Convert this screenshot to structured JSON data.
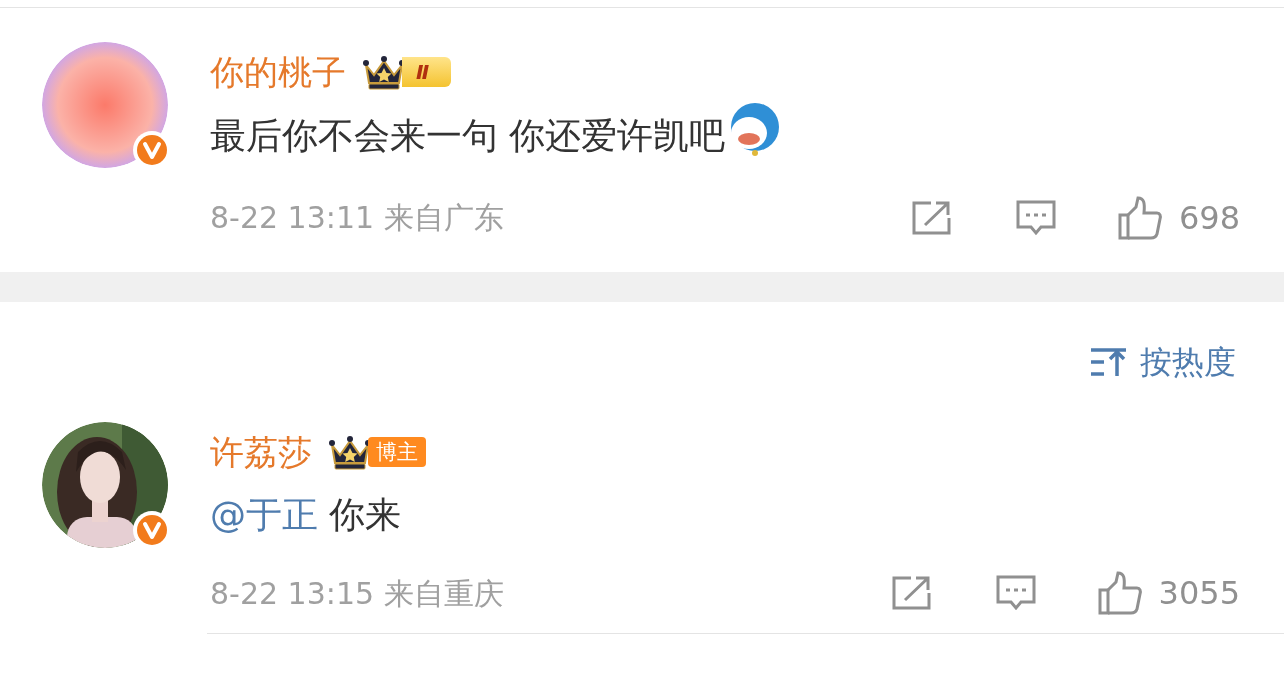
{
  "comments": [
    {
      "name": "你的桃子",
      "avatar": {
        "kind": "gradient"
      },
      "verified": true,
      "badge": {
        "kind": "level",
        "text": "Ⅱ"
      },
      "body": [
        {
          "kind": "text",
          "text": "最后你不会来一句 你还爱许凯吧"
        }
      ],
      "emoji": true,
      "time": "8-22 13:11",
      "location": "来自广东",
      "likes": "698"
    },
    {
      "name": "许荔莎",
      "verified": true,
      "badge": {
        "kind": "role",
        "text": "博主"
      },
      "body": [
        {
          "kind": "mention",
          "text": "@于正"
        },
        {
          "kind": "text",
          "text": " 你来"
        }
      ],
      "emoji": false,
      "time": "8-22 13:15",
      "location": "来自重庆",
      "likes": "3055"
    }
  ],
  "sort": {
    "label": "按热度"
  }
}
